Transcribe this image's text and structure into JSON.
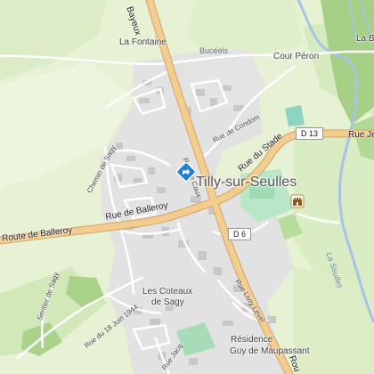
{
  "map": {
    "places": {
      "la_fontaine": "La Fontaine",
      "bucels": "Bucéels",
      "cour_peron": "Cour Péron",
      "la_b": "La B",
      "tilly": "Tilly-sur-Seulles",
      "coteaux_line1": "Les Coteaux",
      "coteaux_line2": "de Sagy",
      "residence_line1": "Résidence",
      "residence_line2": "Guy de Maupassant"
    },
    "roads": {
      "route_bayeux": "Bayeux",
      "route_de_balleroy_west": "Route de Balleroy",
      "rue_de_balleroy": "Rue de Balleroy",
      "rue_de_condom": "Rue de Condom",
      "rue_du_stade": "Rue du Stade",
      "rue_je": "Rue Je",
      "rue_de_caux": "Rue de Caux",
      "chemin_de_sagy": "Chemin de Sagy",
      "sentier_de_sagy": "Sentier de Sagy",
      "rue_18_juin": "Rue du 18 Juin 1944",
      "rue_livry": "Rue Livry Level",
      "route_south": "Rou",
      "rue_jacq": "Rue Jacq"
    },
    "shields": {
      "d13": "D 13",
      "d6": "D 6"
    },
    "water": {
      "la_seulles": "La Seulles"
    },
    "colors": {
      "field": "#e7f1d3",
      "meadow": "#cfe6b2",
      "forest": "#a6d085",
      "urban": "#e2e2e2",
      "building": "#c9c2c2",
      "main_road": "#f3cc8f",
      "minor_road": "#ffffff",
      "river": "#a6c4e6",
      "sports": "#b9e6c6",
      "marker": "#1f80d7"
    },
    "icons": {
      "location": "location-marker-icon",
      "castle": "castle-icon"
    }
  }
}
